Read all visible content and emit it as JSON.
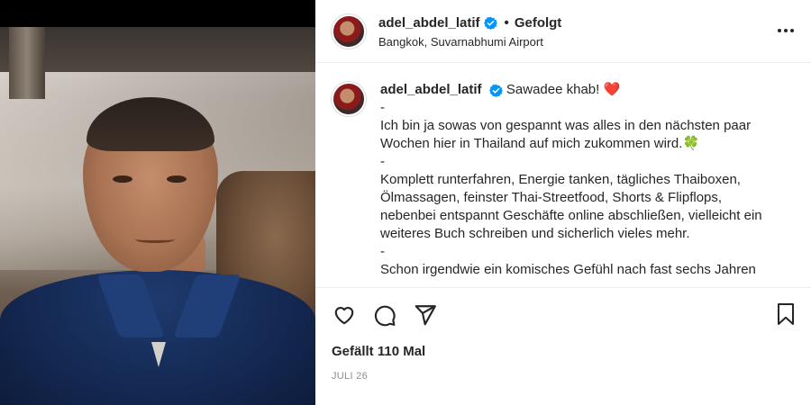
{
  "post": {
    "username": "adel_abdel_latif",
    "separator": "•",
    "follow_state": "Gefolgt",
    "location": "Bangkok, Suvarnabhumi Airport",
    "verified": true
  },
  "caption": {
    "username": "adel_abdel_latif",
    "first_text": "Sawadee khab!",
    "heart": "❤️",
    "lines": {
      "l1": "-",
      "l2": "Ich bin ja sowas von gespannt was alles in den nächsten paar",
      "l3": "Wochen hier in Thailand auf mich zukommen wird.",
      "l4": "-",
      "l5": "Komplett runterfahren, Energie tanken, tägliches Thaiboxen,",
      "l6": "Ölmassagen, feinster Thai-Streetfood, Shorts & Flipflops,",
      "l7": "nebenbei entspannt Geschäfte online abschließen, vielleicht ein",
      "l8": "weiteres Buch schreiben und sicherlich vieles mehr.",
      "l9": "-",
      "l10": "Schon irgendwie ein komisches Gefühl nach fast sechs Jahren"
    },
    "clover": "🍀"
  },
  "engagement": {
    "likes": "Gefällt 110 Mal",
    "date": "JULI 26"
  },
  "icons": {
    "like": "heart-icon",
    "comment": "comment-icon",
    "share": "share-icon",
    "save": "bookmark-icon",
    "more": "more-icon",
    "verified": "verified-icon"
  },
  "colors": {
    "text": "#262626",
    "muted": "#8e8e8e",
    "verified": "#0095f6",
    "heart": "#ed4956",
    "border": "#efefef"
  }
}
